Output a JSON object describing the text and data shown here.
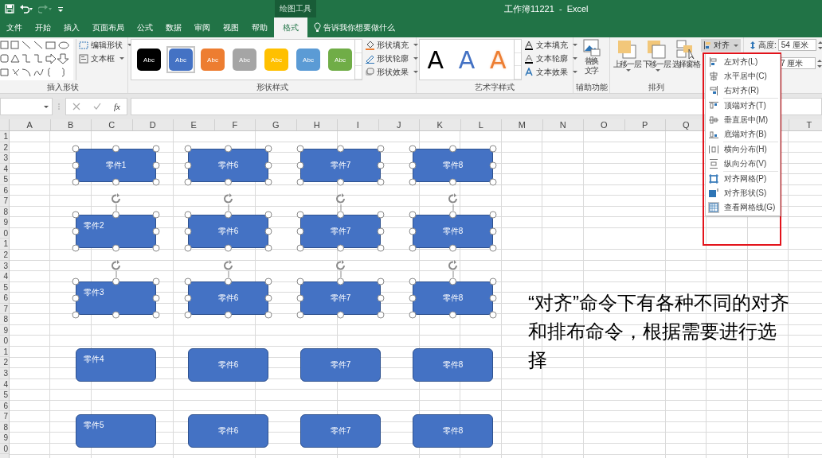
{
  "title_bar": {
    "title": "工作簿11221  -  Excel",
    "context_tab": "绘图工具"
  },
  "tabs": [
    {
      "label": "文件",
      "selected": false
    },
    {
      "label": "开始",
      "selected": false
    },
    {
      "label": "插入",
      "selected": false
    },
    {
      "label": "页面布局",
      "selected": false
    },
    {
      "label": "公式",
      "selected": false
    },
    {
      "label": "数据",
      "selected": false
    },
    {
      "label": "审阅",
      "selected": false
    },
    {
      "label": "视图",
      "selected": false
    },
    {
      "label": "帮助",
      "selected": false
    },
    {
      "label": "格式",
      "selected": true
    }
  ],
  "tell_me": "告诉我你想要做什么",
  "insert_shapes": {
    "label": "插入形状",
    "buttons": [
      "编辑形状",
      "文本框"
    ]
  },
  "shape_styles": {
    "label": "形状样式",
    "presets": [
      {
        "text": "Abc",
        "color": "#000000",
        "selected": false
      },
      {
        "text": "Abc",
        "color": "#4472c4",
        "selected": true
      },
      {
        "text": "Abc",
        "color": "#ed7d31",
        "selected": false
      },
      {
        "text": "Abc",
        "color": "#a5a5a5",
        "selected": false
      },
      {
        "text": "Abc",
        "color": "#ffc000",
        "selected": false
      },
      {
        "text": "Abc",
        "color": "#5b9bd5",
        "selected": false
      },
      {
        "text": "Abc",
        "color": "#70ad47",
        "selected": false
      }
    ],
    "buttons": [
      "形状填充",
      "形状轮廓",
      "形状效果"
    ]
  },
  "wordart_styles": {
    "label": "艺术字样式",
    "presets": [
      {
        "text": "A",
        "kind": "solid",
        "color": "#000000"
      },
      {
        "text": "A",
        "kind": "solid",
        "color": "#4472c4"
      },
      {
        "text": "A",
        "kind": "outline",
        "color": "#ed7d31"
      }
    ],
    "buttons": [
      "文本填充",
      "文本轮廓",
      "文本效果"
    ]
  },
  "accessibility": {
    "label": "辅助功能",
    "button": "替换文字"
  },
  "arrange": {
    "label": "排列",
    "buttons": [
      "上移一层",
      "下移一层",
      "选择窗格"
    ],
    "align_button": "对齐"
  },
  "size": {
    "height_label": "高度:",
    "height_value": "54 厘米",
    "width_value": "7 厘米"
  },
  "formula_bar": {
    "function_label": "fx"
  },
  "align_menu": {
    "groups": [
      {
        "items": [
          "左对齐(L)",
          "水平居中(C)",
          "右对齐(R)"
        ]
      },
      {
        "items": [
          "顶端对齐(T)",
          "垂直居中(M)",
          "底端对齐(B)"
        ]
      },
      {
        "items": [
          "横向分布(H)",
          "纵向分布(V)"
        ]
      },
      {
        "items": [
          "对齐网格(P)",
          "对齐形状(S)",
          "查看网格线(G)"
        ]
      }
    ]
  },
  "sheet": {
    "columns": [
      "A",
      "B",
      "C",
      "D",
      "E",
      "F",
      "G",
      "H",
      "I",
      "J",
      "K",
      "L",
      "M",
      "N",
      "O",
      "P",
      "Q"
    ],
    "columns_right": [
      "T"
    ],
    "row_labels": [
      "1",
      "2",
      "3",
      "4",
      "5",
      "6",
      "7",
      "8",
      "9",
      "0",
      "1",
      "2",
      "3",
      "4",
      "5",
      "6",
      "7",
      "8",
      "9",
      "0",
      "1",
      "2",
      "3",
      "4",
      "5",
      "6",
      "7",
      "8",
      "9",
      "0"
    ],
    "shape_rows": [
      {
        "shapes": [
          {
            "label": "零件1",
            "selected": true,
            "text_centered": true
          },
          {
            "label": "零件6",
            "selected": true,
            "text_centered": true
          },
          {
            "label": "零件7",
            "selected": true,
            "text_centered": true
          },
          {
            "label": "零件8",
            "selected": true,
            "text_centered": true
          }
        ]
      },
      {
        "shapes": [
          {
            "label": "零件2",
            "selected": true,
            "text_centered": false
          },
          {
            "label": "零件6",
            "selected": true,
            "text_centered": true
          },
          {
            "label": "零件7",
            "selected": true,
            "text_centered": true
          },
          {
            "label": "零件8",
            "selected": true,
            "text_centered": true
          }
        ]
      },
      {
        "shapes": [
          {
            "label": "零件3",
            "selected": true,
            "text_centered": false
          },
          {
            "label": "零件6",
            "selected": true,
            "text_centered": true
          },
          {
            "label": "零件7",
            "selected": true,
            "text_centered": true
          },
          {
            "label": "零件8",
            "selected": true,
            "text_centered": true
          }
        ]
      },
      {
        "shapes": [
          {
            "label": "零件4",
            "selected": false,
            "text_centered": false
          },
          {
            "label": "零件6",
            "selected": false,
            "text_centered": true
          },
          {
            "label": "零件7",
            "selected": false,
            "text_centered": true
          },
          {
            "label": "零件8",
            "selected": false,
            "text_centered": true
          }
        ]
      },
      {
        "shapes": [
          {
            "label": "零件5",
            "selected": false,
            "text_centered": false
          },
          {
            "label": "零件6",
            "selected": false,
            "text_centered": true
          },
          {
            "label": "零件7",
            "selected": false,
            "text_centered": true
          },
          {
            "label": "零件8",
            "selected": false,
            "text_centered": true
          }
        ]
      }
    ],
    "annotation": "“对齐”命令下有各种不同的对齐和排布命令，根据需要进行选择"
  }
}
